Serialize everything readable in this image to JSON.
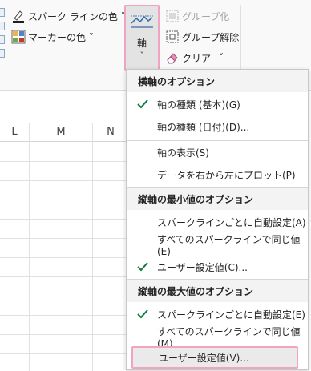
{
  "ribbon": {
    "sparkline_color_label": "スパーク ラインの色 ˅",
    "marker_color_label": "マーカーの色 ˅",
    "axis_label": "軸",
    "axis_chevron": "˅",
    "group_label": "グループ化",
    "ungroup_label": "グループ解除",
    "clear_label": "クリア",
    "clear_chevron": "˅"
  },
  "sheet": {
    "columns": [
      "L",
      "M",
      "N"
    ]
  },
  "menu": {
    "sections": [
      {
        "header": "横軸のオプション",
        "items": [
          {
            "label": "軸の種類 (基本)(G)",
            "checked": true
          },
          {
            "label": "軸の種類 (日付)(D)...",
            "checked": false
          }
        ]
      },
      {
        "header": "",
        "items": [
          {
            "label": "軸の表示(S)",
            "checked": false
          },
          {
            "label": "データを右から左にプロット(P)",
            "checked": false
          }
        ]
      },
      {
        "header": "縦軸の最小値のオプション",
        "items": [
          {
            "label": "スパークラインごとに自動設定(A)",
            "checked": false
          },
          {
            "label": "すべてのスパークラインで同じ値(E)",
            "checked": false
          },
          {
            "label": "ユーザー設定値(C)...",
            "checked": true
          }
        ]
      },
      {
        "header": "縦軸の最大値のオプション",
        "items": [
          {
            "label": "スパークラインごとに自動設定(E)",
            "checked": true
          },
          {
            "label": "すべてのスパークラインで同じ値(M)",
            "checked": false
          },
          {
            "label": "ユーザー設定値(V)...",
            "checked": false,
            "highlighted": true
          }
        ]
      }
    ]
  },
  "colors": {
    "highlight_border": "#f0a3c2",
    "check_green": "#107c41",
    "menu_header_bg": "#f3f3f3"
  }
}
